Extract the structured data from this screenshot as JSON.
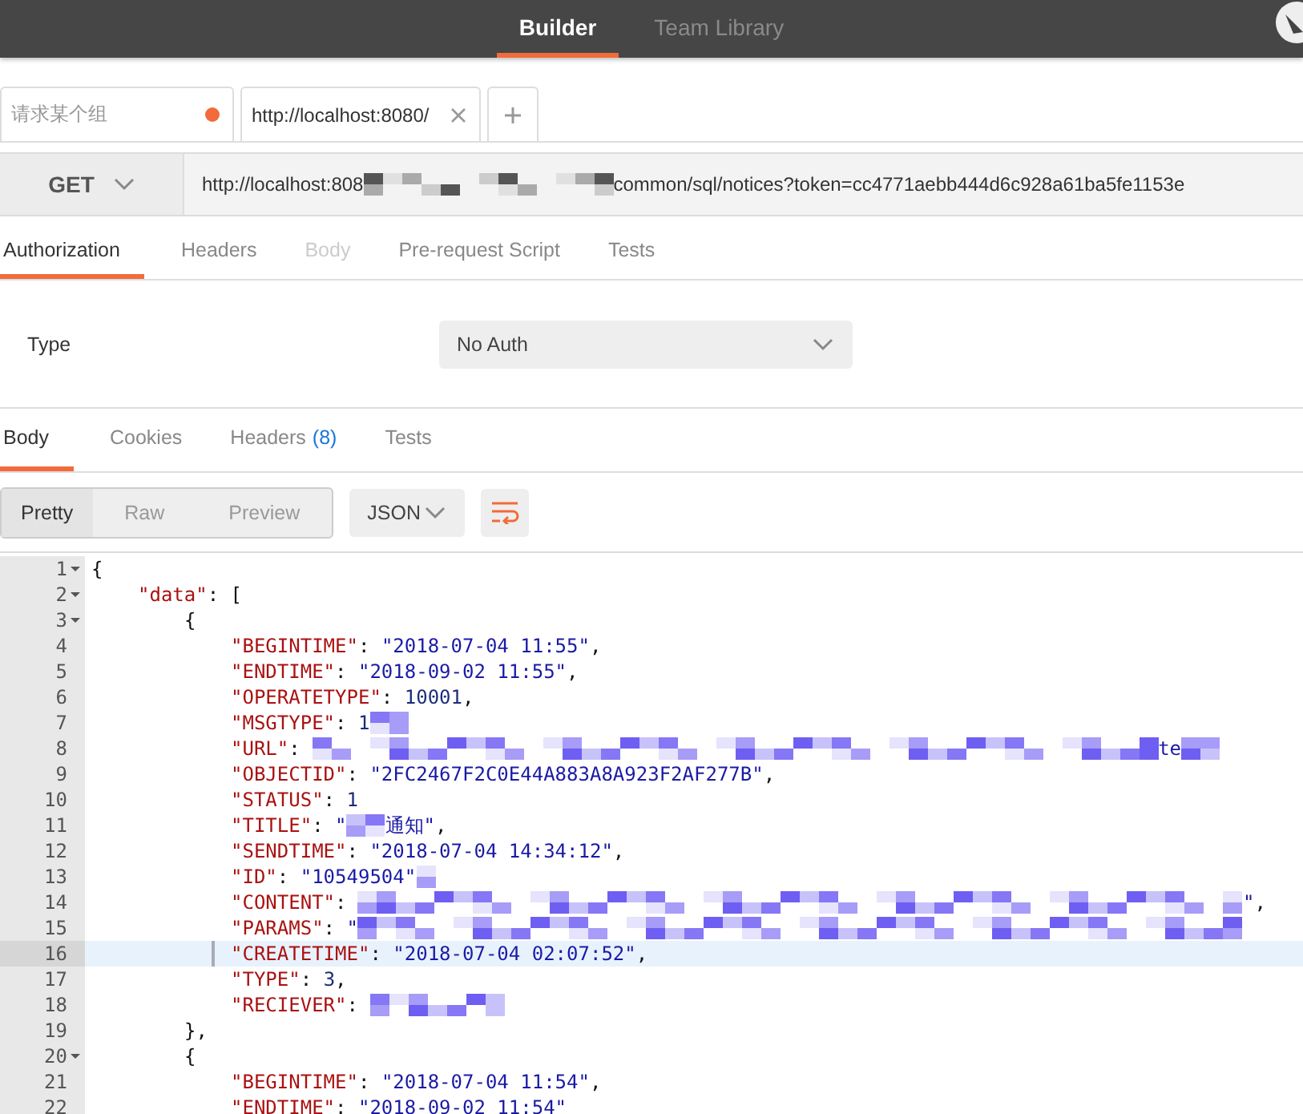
{
  "top_bar": {
    "tabs": [
      {
        "label": "Builder",
        "selected": true
      },
      {
        "label": "Team Library",
        "selected": false
      }
    ]
  },
  "request_tabs": [
    {
      "label": "请求某个组",
      "kind": "field",
      "unsaved": true
    },
    {
      "label": "http://localhost:8080/",
      "kind": "tab",
      "unsaved": false
    }
  ],
  "url_bar": {
    "method": "GET",
    "url_start": "http://localhost:808",
    "url_end": "common/sql/notices?token=cc4771aebb444d6c928a61ba5fe1153e"
  },
  "request_sections": [
    {
      "label": "Authorization",
      "selected": true,
      "disabled": false
    },
    {
      "label": "Headers",
      "selected": false,
      "disabled": false
    },
    {
      "label": "Body",
      "selected": false,
      "disabled": true
    },
    {
      "label": "Pre-request Script",
      "selected": false,
      "disabled": false
    },
    {
      "label": "Tests",
      "selected": false,
      "disabled": false
    }
  ],
  "auth": {
    "label": "Type",
    "value": "No Auth"
  },
  "response_tabs": [
    {
      "label": "Body",
      "selected": true
    },
    {
      "label": "Cookies",
      "selected": false
    },
    {
      "label": "Headers",
      "count": "(8)",
      "selected": false
    },
    {
      "label": "Tests",
      "selected": false
    }
  ],
  "view_modes": [
    {
      "label": "Pretty",
      "selected": true
    },
    {
      "label": "Raw",
      "selected": false
    },
    {
      "label": "Preview",
      "selected": false
    }
  ],
  "format": "JSON",
  "code": [
    {
      "num": "1",
      "fold": true,
      "selected": false,
      "tokens": [
        {
          "kind": "punct",
          "text": "{"
        }
      ],
      "children": [
        {
          "num": "2",
          "fold": true,
          "selected": false,
          "tokens": [
            {
              "kind": "key",
              "text": "\"data\""
            },
            {
              "kind": "punct",
              "text": ": ["
            }
          ],
          "children": [
            {
              "num": "3",
              "fold": true,
              "selected": false,
              "tokens": [
                {
                  "kind": "punct",
                  "text": "{"
                }
              ],
              "children": [
                {
                  "num": "4",
                  "fold": false,
                  "selected": false,
                  "tokens": [
                    {
                      "kind": "key",
                      "text": "\"BEGINTIME\""
                    },
                    {
                      "kind": "punct",
                      "text": ": "
                    },
                    {
                      "kind": "string",
                      "text": "\"2018-07-04 11:55\""
                    },
                    {
                      "kind": "punct",
                      "text": ","
                    }
                  ]
                },
                {
                  "num": "5",
                  "fold": false,
                  "selected": false,
                  "tokens": [
                    {
                      "kind": "key",
                      "text": "\"ENDTIME\""
                    },
                    {
                      "kind": "punct",
                      "text": ": "
                    },
                    {
                      "kind": "string",
                      "text": "\"2018-09-02 11:55\""
                    },
                    {
                      "kind": "punct",
                      "text": ","
                    }
                  ]
                },
                {
                  "num": "6",
                  "fold": false,
                  "selected": false,
                  "tokens": [
                    {
                      "kind": "key",
                      "text": "\"OPERATETYPE\""
                    },
                    {
                      "kind": "punct",
                      "text": ": "
                    },
                    {
                      "kind": "number",
                      "text": "10001"
                    },
                    {
                      "kind": "punct",
                      "text": ","
                    }
                  ]
                },
                {
                  "num": "7",
                  "fold": false,
                  "selected": false,
                  "tokens": [
                    {
                      "kind": "key",
                      "text": "\"MSGTYPE\""
                    },
                    {
                      "kind": "punct",
                      "text": ": "
                    },
                    {
                      "kind": "number",
                      "text": "1"
                    },
                    {
                      "kind": "redacted"
                    }
                  ]
                },
                {
                  "num": "8",
                  "fold": false,
                  "selected": false,
                  "tokens": [
                    {
                      "kind": "key",
                      "text": "\"URL\""
                    },
                    {
                      "kind": "punct",
                      "text": ": "
                    },
                    {
                      "kind": "redacted"
                    },
                    {
                      "kind": "string",
                      "text": "te"
                    },
                    {
                      "kind": "redacted"
                    }
                  ]
                },
                {
                  "num": "9",
                  "fold": false,
                  "selected": false,
                  "tokens": [
                    {
                      "kind": "key",
                      "text": "\"OBJECTID\""
                    },
                    {
                      "kind": "punct",
                      "text": ": "
                    },
                    {
                      "kind": "string",
                      "text": "\"2FC2467F2C0E44A883A8A923F2AF277B\""
                    },
                    {
                      "kind": "punct",
                      "text": ","
                    }
                  ]
                },
                {
                  "num": "10",
                  "fold": false,
                  "selected": false,
                  "tokens": [
                    {
                      "kind": "key",
                      "text": "\"STATUS\""
                    },
                    {
                      "kind": "punct",
                      "text": ": "
                    },
                    {
                      "kind": "number",
                      "text": "1"
                    }
                  ]
                },
                {
                  "num": "11",
                  "fold": false,
                  "selected": false,
                  "tokens": [
                    {
                      "kind": "key",
                      "text": "\"TITLE\""
                    },
                    {
                      "kind": "punct",
                      "text": ": "
                    },
                    {
                      "kind": "string",
                      "text": "\""
                    },
                    {
                      "kind": "redacted"
                    },
                    {
                      "kind": "string",
                      "text": "通知\""
                    },
                    {
                      "kind": "punct",
                      "text": ","
                    }
                  ]
                },
                {
                  "num": "12",
                  "fold": false,
                  "selected": false,
                  "tokens": [
                    {
                      "kind": "key",
                      "text": "\"SENDTIME\""
                    },
                    {
                      "kind": "punct",
                      "text": ": "
                    },
                    {
                      "kind": "string",
                      "text": "\"2018-07-04 14:34:12\""
                    },
                    {
                      "kind": "punct",
                      "text": ","
                    }
                  ]
                },
                {
                  "num": "13",
                  "fold": false,
                  "selected": false,
                  "tokens": [
                    {
                      "kind": "key",
                      "text": "\"ID\""
                    },
                    {
                      "kind": "punct",
                      "text": ": "
                    },
                    {
                      "kind": "string",
                      "text": "\"10549504\""
                    },
                    {
                      "kind": "redacted"
                    }
                  ]
                },
                {
                  "num": "14",
                  "fold": false,
                  "selected": false,
                  "tokens": [
                    {
                      "kind": "key",
                      "text": "\"CONTENT\""
                    },
                    {
                      "kind": "punct",
                      "text": ": "
                    },
                    {
                      "kind": "redacted"
                    },
                    {
                      "kind": "string",
                      "text": "\""
                    },
                    {
                      "kind": "punct",
                      "text": ","
                    }
                  ]
                },
                {
                  "num": "15",
                  "fold": false,
                  "selected": false,
                  "tokens": [
                    {
                      "kind": "key",
                      "text": "\"PARAMS\""
                    },
                    {
                      "kind": "punct",
                      "text": ": "
                    },
                    {
                      "kind": "string",
                      "text": "\""
                    },
                    {
                      "kind": "redacted"
                    }
                  ]
                },
                {
                  "num": "16",
                  "fold": false,
                  "selected": true,
                  "tokens": [
                    {
                      "kind": "key",
                      "text": "\"CREATETIME\""
                    },
                    {
                      "kind": "punct",
                      "text": ": "
                    },
                    {
                      "kind": "string",
                      "text": "\"2018-07-04 02:07:52\""
                    },
                    {
                      "kind": "punct",
                      "text": ","
                    }
                  ]
                },
                {
                  "num": "17",
                  "fold": false,
                  "selected": false,
                  "tokens": [
                    {
                      "kind": "key",
                      "text": "\"TYPE\""
                    },
                    {
                      "kind": "punct",
                      "text": ": "
                    },
                    {
                      "kind": "number",
                      "text": "3"
                    },
                    {
                      "kind": "punct",
                      "text": ","
                    }
                  ]
                },
                {
                  "num": "18",
                  "fold": false,
                  "selected": false,
                  "tokens": [
                    {
                      "kind": "key",
                      "text": "\"RECIEVER\""
                    },
                    {
                      "kind": "punct",
                      "text": ": "
                    },
                    {
                      "kind": "redacted"
                    }
                  ]
                }
              ]
            },
            {
              "num": "19",
              "fold": false,
              "selected": false,
              "tokens": [
                {
                  "kind": "punct",
                  "text": "},"
                }
              ]
            },
            {
              "num": "20",
              "fold": true,
              "selected": false,
              "tokens": [
                {
                  "kind": "punct",
                  "text": "{"
                }
              ],
              "children": [
                {
                  "num": "21",
                  "fold": false,
                  "selected": false,
                  "tokens": [
                    {
                      "kind": "key",
                      "text": "\"BEGINTIME\""
                    },
                    {
                      "kind": "punct",
                      "text": ": "
                    },
                    {
                      "kind": "string",
                      "text": "\"2018-07-04 11:54\""
                    },
                    {
                      "kind": "punct",
                      "text": ","
                    }
                  ]
                },
                {
                  "num": "22",
                  "fold": false,
                  "selected": false,
                  "tokens": [
                    {
                      "kind": "key",
                      "text": "\"ENDTIME\""
                    },
                    {
                      "kind": "punct",
                      "text": ": "
                    },
                    {
                      "kind": "string",
                      "text": "\"2018-09-02 11:54\""
                    }
                  ]
                }
              ]
            }
          ]
        }
      ]
    }
  ]
}
